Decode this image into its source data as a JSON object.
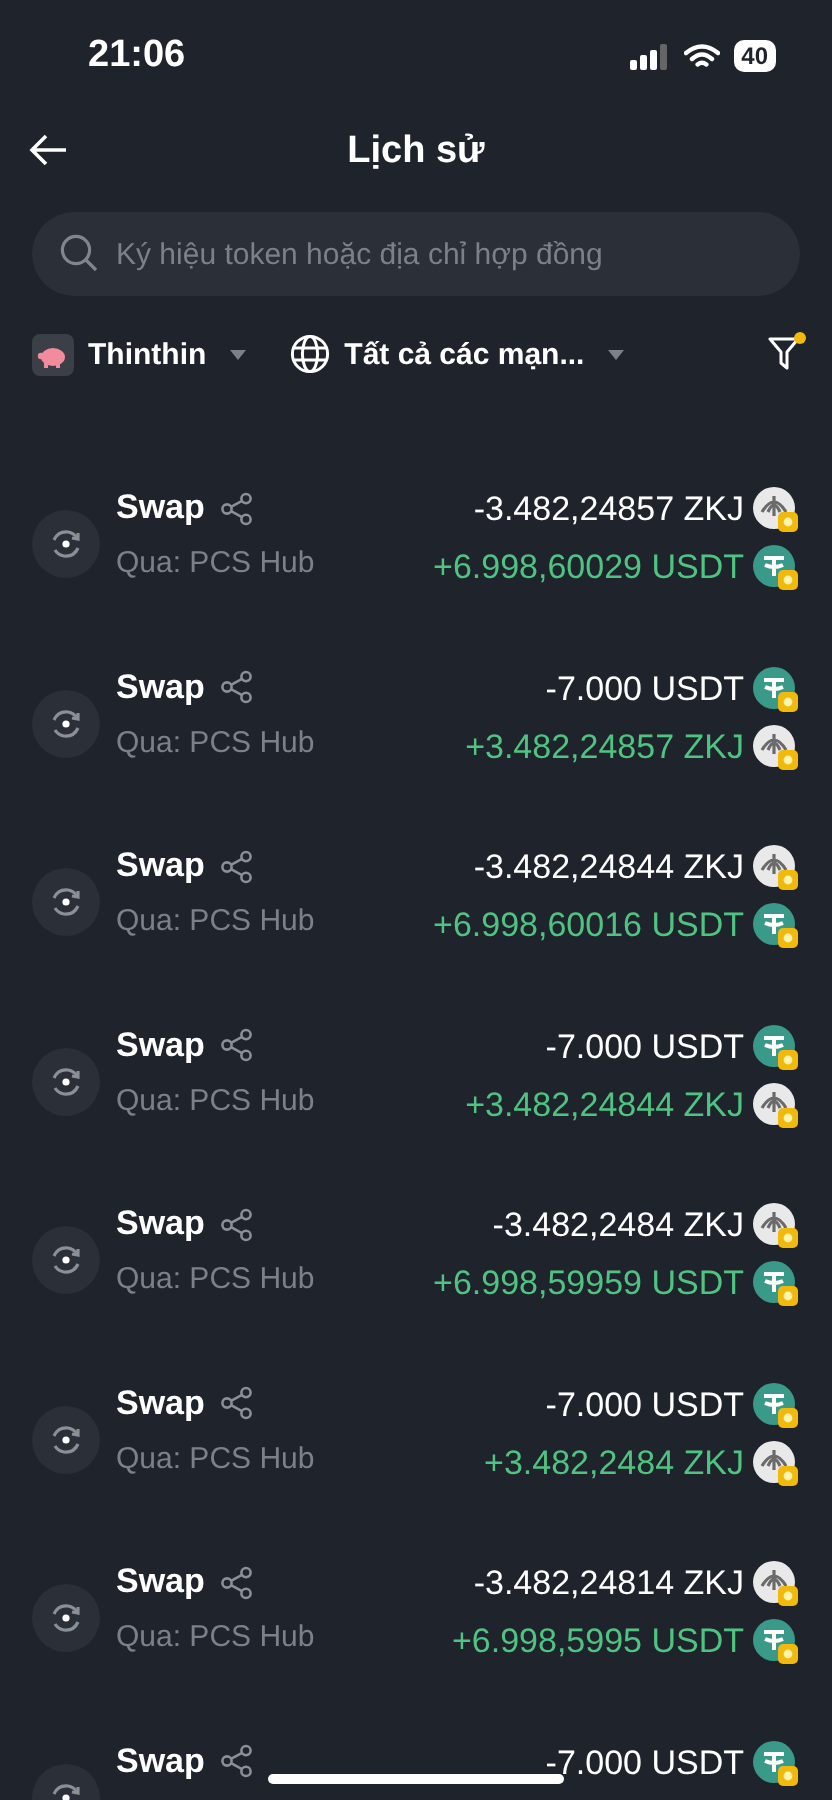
{
  "status_bar": {
    "time": "21:06",
    "battery": "40"
  },
  "header": {
    "title": "Lịch sử"
  },
  "search": {
    "placeholder": "Ký hiệu token hoặc địa chỉ hợp đồng"
  },
  "filters": {
    "wallet": "Thinthin",
    "network": "Tất cả các mạn...",
    "filter_active": true
  },
  "transactions": [
    {
      "title": "Swap",
      "via": "Qua: PCS Hub",
      "amounts": [
        {
          "text": "-3.482,24857 ZKJ",
          "received": false,
          "kind": "zkj"
        },
        {
          "text": "+6.998,60029 USDT",
          "received": true,
          "kind": "usdt"
        }
      ]
    },
    {
      "title": "Swap",
      "via": "Qua: PCS Hub",
      "amounts": [
        {
          "text": "-7.000 USDT",
          "received": false,
          "kind": "usdt"
        },
        {
          "text": "+3.482,24857 ZKJ",
          "received": true,
          "kind": "zkj"
        }
      ]
    },
    {
      "title": "Swap",
      "via": "Qua: PCS Hub",
      "amounts": [
        {
          "text": "-3.482,24844 ZKJ",
          "received": false,
          "kind": "zkj"
        },
        {
          "text": "+6.998,60016 USDT",
          "received": true,
          "kind": "usdt"
        }
      ]
    },
    {
      "title": "Swap",
      "via": "Qua: PCS Hub",
      "amounts": [
        {
          "text": "-7.000 USDT",
          "received": false,
          "kind": "usdt"
        },
        {
          "text": "+3.482,24844 ZKJ",
          "received": true,
          "kind": "zkj"
        }
      ]
    },
    {
      "title": "Swap",
      "via": "Qua: PCS Hub",
      "amounts": [
        {
          "text": "-3.482,2484 ZKJ",
          "received": false,
          "kind": "zkj"
        },
        {
          "text": "+6.998,59959 USDT",
          "received": true,
          "kind": "usdt"
        }
      ]
    },
    {
      "title": "Swap",
      "via": "Qua: PCS Hub",
      "amounts": [
        {
          "text": "-7.000 USDT",
          "received": false,
          "kind": "usdt"
        },
        {
          "text": "+3.482,2484 ZKJ",
          "received": true,
          "kind": "zkj"
        }
      ]
    },
    {
      "title": "Swap",
      "via": "Qua: PCS Hub",
      "amounts": [
        {
          "text": "-3.482,24814 ZKJ",
          "received": false,
          "kind": "zkj"
        },
        {
          "text": "+6.998,5995 USDT",
          "received": true,
          "kind": "usdt"
        }
      ]
    },
    {
      "title": "Swap",
      "amounts": [
        {
          "text": "-7.000 USDT",
          "received": false,
          "kind": "usdt"
        }
      ]
    }
  ]
}
